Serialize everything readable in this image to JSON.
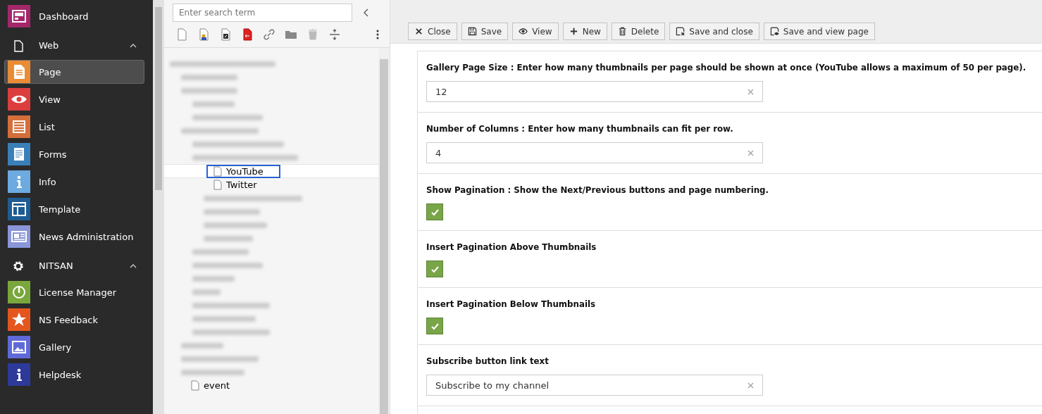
{
  "sidebar": {
    "items": [
      {
        "kind": "module",
        "label": "Dashboard",
        "color": "#a4276a",
        "selected": false
      },
      {
        "kind": "group",
        "label": "Web",
        "expanded": true
      },
      {
        "kind": "module",
        "label": "Page",
        "color": "#e98c35",
        "selected": true
      },
      {
        "kind": "module",
        "label": "View",
        "color": "#dc3e3e",
        "selected": false
      },
      {
        "kind": "module",
        "label": "List",
        "color": "#d46e3a",
        "selected": false
      },
      {
        "kind": "module",
        "label": "Forms",
        "color": "#3a80b8",
        "selected": false
      },
      {
        "kind": "module",
        "label": "Info",
        "color": "#6daae0",
        "selected": false
      },
      {
        "kind": "module",
        "label": "Template",
        "color": "#1e5c93",
        "selected": false
      },
      {
        "kind": "module",
        "label": "News Administration",
        "color": "#8a96d8",
        "selected": false
      },
      {
        "kind": "group",
        "label": "NITSAN",
        "expanded": true
      },
      {
        "kind": "module",
        "label": "License Manager",
        "color": "#7aa73b",
        "selected": false
      },
      {
        "kind": "module",
        "label": "NS Feedback",
        "color": "#e4561e",
        "selected": false
      },
      {
        "kind": "module",
        "label": "Gallery",
        "color": "#5f6ad8",
        "selected": false
      },
      {
        "kind": "module",
        "label": "Helpdesk",
        "color": "#2d3a9a",
        "selected": false
      }
    ]
  },
  "tree": {
    "search": {
      "placeholder": "Enter search term"
    },
    "items": [
      {
        "label": "YouTube",
        "selected": true
      },
      {
        "label": "Twitter",
        "selected": false
      },
      {
        "label": "event",
        "selected": false
      }
    ]
  },
  "toolbar": {
    "buttons": [
      {
        "label": "Close"
      },
      {
        "label": "Save"
      },
      {
        "label": "View"
      },
      {
        "label": "New"
      },
      {
        "label": "Delete"
      },
      {
        "label": "Save and close"
      },
      {
        "label": "Save and view page"
      }
    ]
  },
  "form": {
    "fields": [
      {
        "kind": "text",
        "label": "Gallery Page Size : Enter how many thumbnails per page should be shown at once (YouTube allows a maximum of 50 per page).",
        "value": "12"
      },
      {
        "kind": "text",
        "label": "Number of Columns : Enter how many thumbnails can fit per row.",
        "value": "4"
      },
      {
        "kind": "checkbox",
        "label": "Show Pagination : Show the Next/Previous buttons and page numbering.",
        "checked": true
      },
      {
        "kind": "checkbox",
        "label": "Insert Pagination Above Thumbnails",
        "checked": true
      },
      {
        "kind": "checkbox",
        "label": "Insert Pagination Below Thumbnails",
        "checked": true
      },
      {
        "kind": "text",
        "label": "Subscribe button link text",
        "value": "Subscribe to my channel"
      }
    ]
  }
}
